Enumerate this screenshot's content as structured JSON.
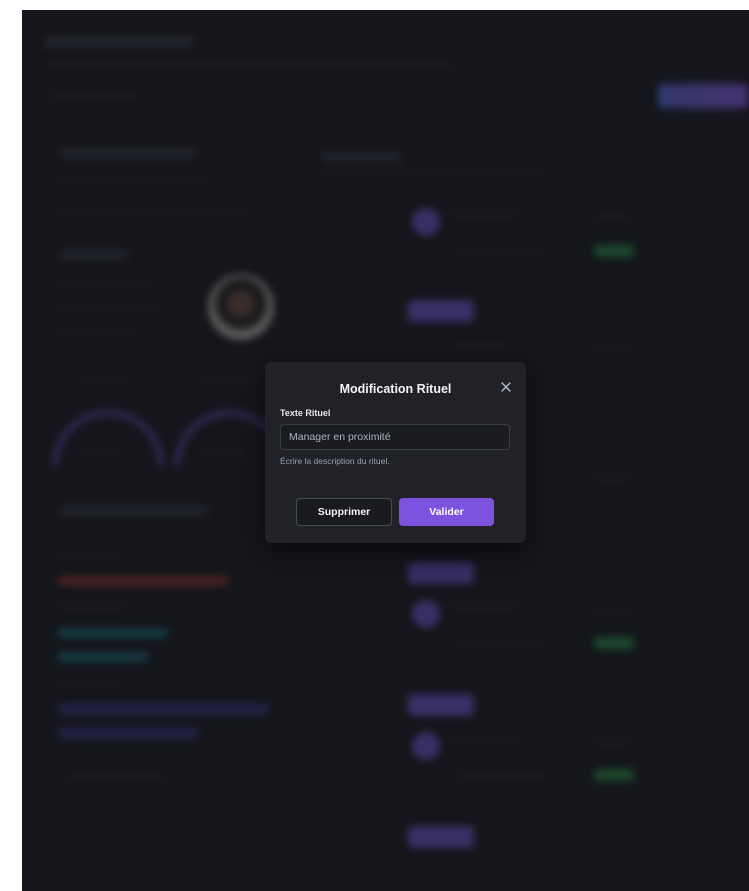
{
  "modal": {
    "title": "Modification Rituel",
    "close_icon": "close-icon",
    "field_label": "Texte Rituel",
    "field_value": "Manager en proximité",
    "field_help": "Écrire la description du rituel.",
    "delete_label": "Supprimer",
    "validate_label": "Valider"
  },
  "colors": {
    "modal_bg": "#212228",
    "primary": "#7d52df",
    "page_bg": "#1d1f25"
  }
}
